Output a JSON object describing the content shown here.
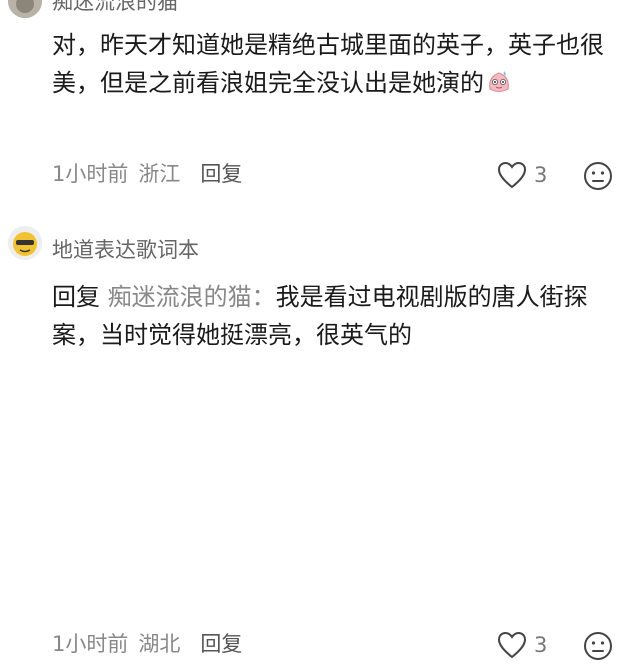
{
  "comments": [
    {
      "username": "痴迷流浪的猫",
      "text": "对，昨天才知道她是精绝古城里面的英子，英子也很美，但是之前看浪姐完全没认出是她演的",
      "time": "1小时前",
      "location": "浙江",
      "reply_label": "回复",
      "likes": "3"
    },
    {
      "username": "地道表达歌词本",
      "reply_prefix": "回复",
      "reply_target": "痴迷流浪的猫：",
      "text": "我是看过电视剧版的唐人街探案，当时觉得她挺漂亮，很英气的",
      "time": "1小时前",
      "location": "湖北",
      "reply_label": "回复",
      "likes": "3"
    }
  ],
  "colors": {
    "meta": "#888888",
    "username": "#666666",
    "body": "#1a1a1a"
  },
  "icons": [
    "heart-outline-icon",
    "neutral-face-icon",
    "blushing-emoji-icon"
  ]
}
